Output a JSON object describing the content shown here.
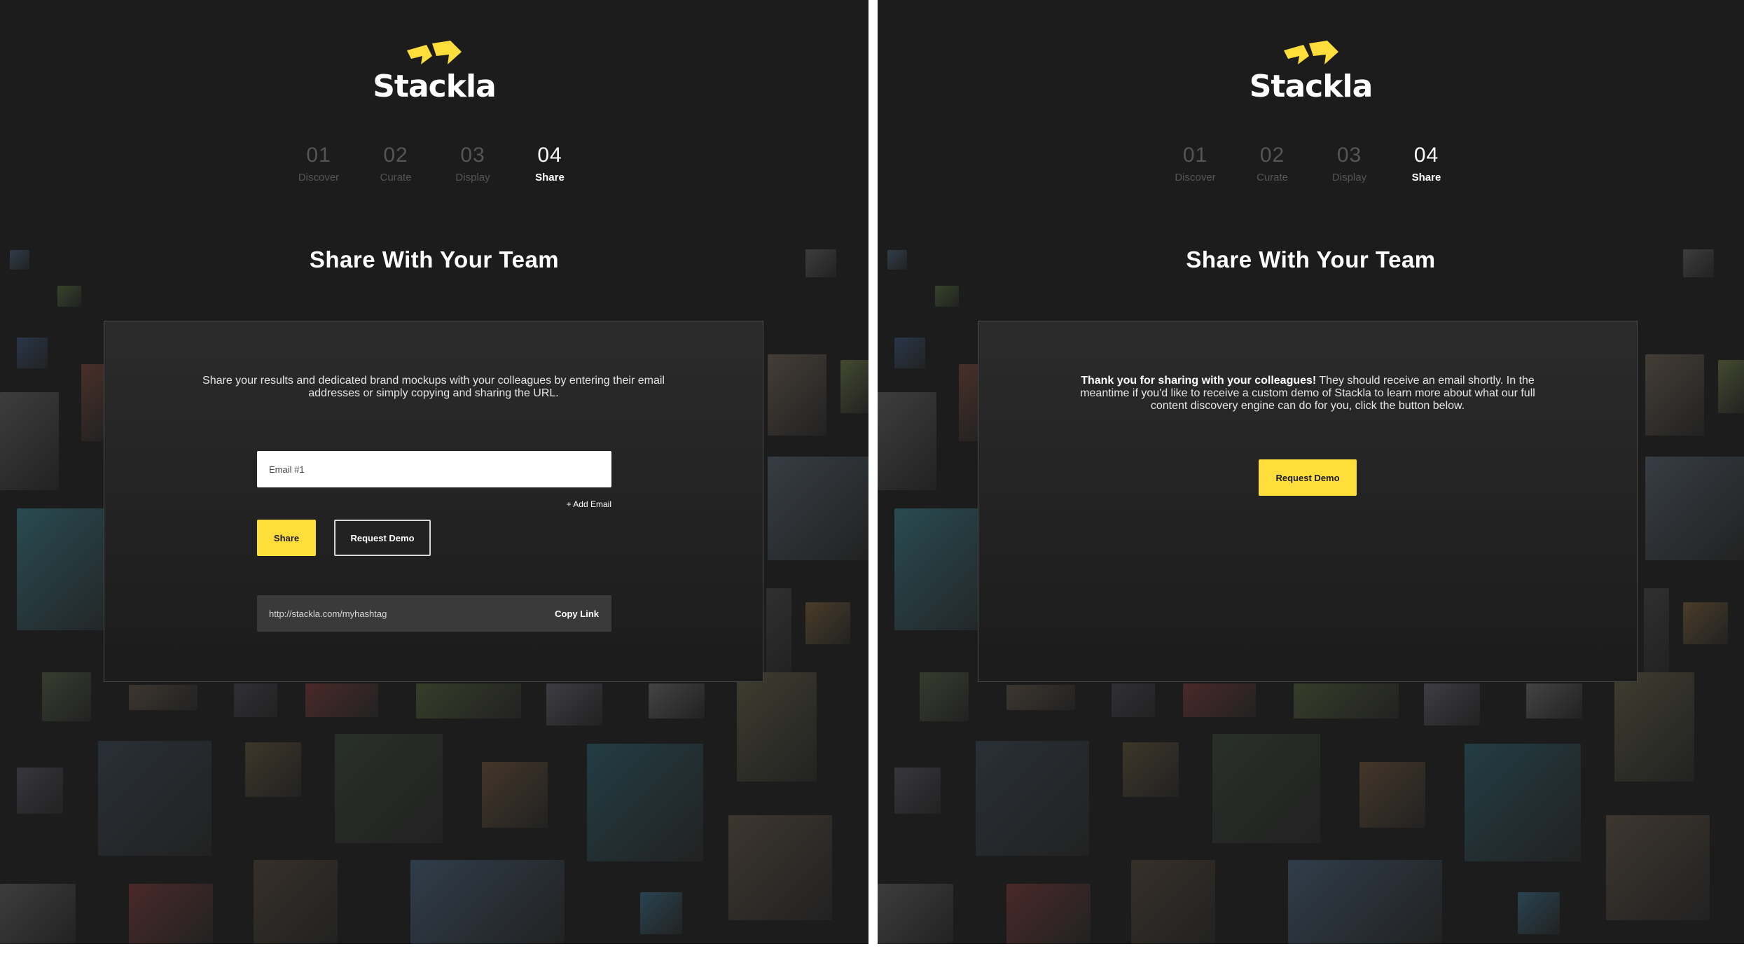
{
  "brand": {
    "name": "Stackla",
    "accent_color": "#ffdd3a",
    "logo_icon": "stackla-chevrons-icon"
  },
  "steps": [
    {
      "number": "01",
      "label": "Discover",
      "active": false
    },
    {
      "number": "02",
      "label": "Curate",
      "active": false
    },
    {
      "number": "03",
      "label": "Display",
      "active": false
    },
    {
      "number": "04",
      "label": "Share",
      "active": true
    }
  ],
  "left_panel": {
    "title": "Share With Your Team",
    "description": "Share your results and dedicated brand mockups with your colleagues by entering their email addresses or simply copying and sharing the URL.",
    "email_placeholder": "Email #1",
    "add_email_label": "+ Add Email",
    "share_label": "Share",
    "request_demo_label": "Request Demo",
    "share_url": "http://stackla.com/myhashtag",
    "copy_link_label": "Copy Link"
  },
  "right_panel": {
    "title": "Share With Your Team",
    "thanks_bold": "Thank you for sharing with your colleagues!",
    "thanks_rest": " They should receive an email shortly. In the meantime if you'd like to receive a custom demo of Stackla to learn more about what our full content discovery engine can do for you, click the button below.",
    "request_demo_label": "Request Demo"
  }
}
